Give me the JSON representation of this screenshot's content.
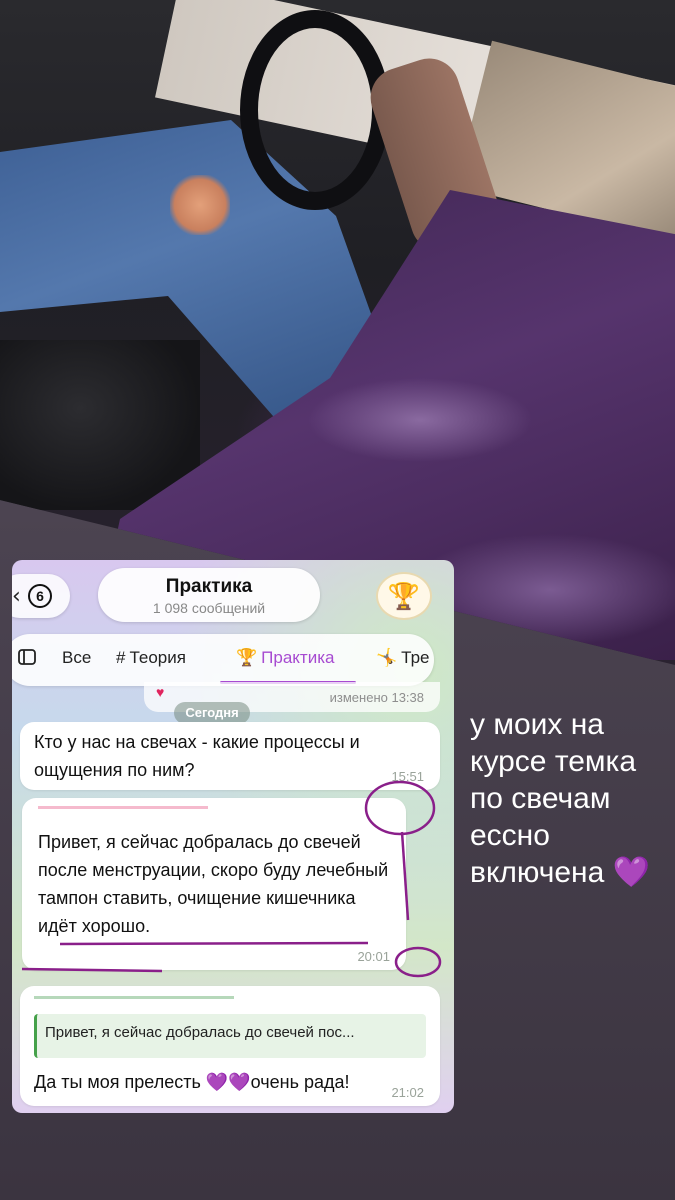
{
  "chat": {
    "back_count": "6",
    "title": "Практика",
    "subtitle": "1 098 сообщений",
    "avatar_icon": "trophy-icon",
    "tabs": [
      {
        "label": "Все",
        "icon": ""
      },
      {
        "label": "Теория",
        "icon": "#"
      },
      {
        "label": "Практика",
        "icon": "🏆"
      },
      {
        "label": "Тре",
        "icon": "🤸"
      }
    ],
    "active_tab": "Практика",
    "accent_color": "#a74bd1",
    "previous_message_time": "изменено 13:38",
    "date_divider": "Сегодня",
    "messages": [
      {
        "text": "Кто у нас на свечах - какие процессы и ощущения по ним?",
        "time": "15:51"
      },
      {
        "text": "Привет, я сейчас добралась до свечей после менструации, скоро буду лечебный тампон ставить, очищение кишечника идёт хорошо.",
        "time": "20:01"
      },
      {
        "reply_quote": "Привет, я сейчас добралась до свечей пос...",
        "text": "Да ты моя прелесть 💜💜очень рада!",
        "time": "21:02"
      }
    ]
  },
  "caption": "у моих на курсе темка по свечам ессно включена 💜"
}
